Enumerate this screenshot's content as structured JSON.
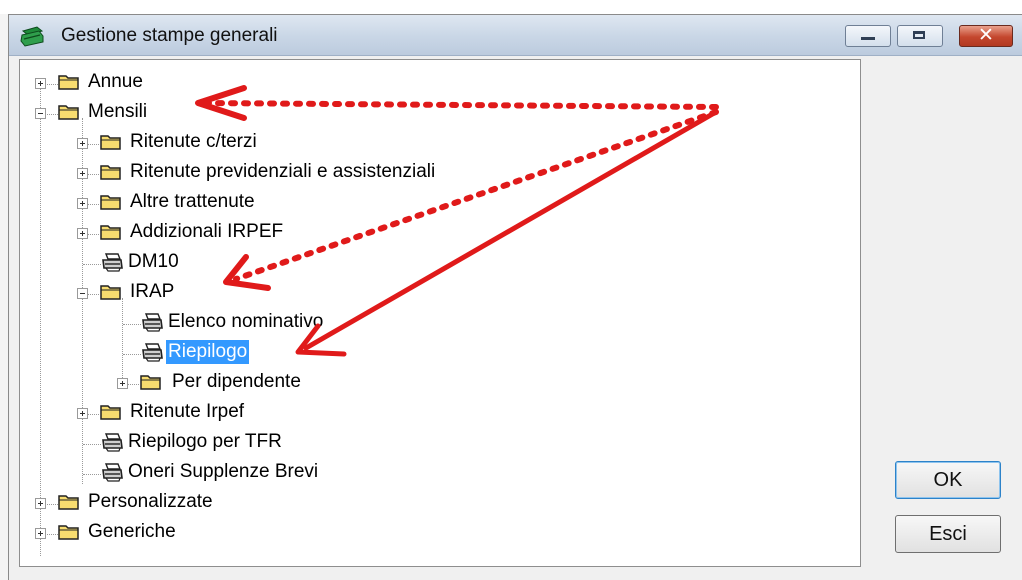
{
  "window": {
    "title": "Gestione stampe generali"
  },
  "tree": {
    "root_items": [
      {
        "label": "Annue",
        "type": "folder",
        "expanded": false
      },
      {
        "label": "Mensili",
        "type": "folder",
        "expanded": true
      },
      {
        "label": "Personalizzate",
        "type": "folder",
        "expanded": false
      },
      {
        "label": "Generiche",
        "type": "folder",
        "expanded": false
      }
    ],
    "mensili_children": [
      {
        "label": "Ritenute c/terzi",
        "type": "folder"
      },
      {
        "label": "Ritenute previdenziali e assistenziali",
        "type": "folder"
      },
      {
        "label": "Altre trattenute",
        "type": "folder"
      },
      {
        "label": "Addizionali IRPEF",
        "type": "folder"
      },
      {
        "label": "DM10",
        "type": "report"
      },
      {
        "label": "IRAP",
        "type": "folder",
        "expanded": true
      },
      {
        "label": "Ritenute Irpef",
        "type": "folder"
      },
      {
        "label": "Riepilogo per TFR",
        "type": "report"
      },
      {
        "label": "Oneri Supplenze Brevi",
        "type": "report"
      }
    ],
    "irap_children": [
      {
        "label": "Elenco nominativo",
        "type": "report"
      },
      {
        "label": "Riepilogo",
        "type": "report",
        "selected": true
      },
      {
        "label": "Per dipendente",
        "type": "folder"
      }
    ]
  },
  "buttons": {
    "ok_label": "OK",
    "esci_label": "Esci"
  },
  "colors": {
    "selection": "#3399ff",
    "annotation_arrows": "#e01a1a",
    "folder_fill": "#f7dc6f"
  },
  "icons": {
    "app": "printer-app-icon",
    "folder": "folder-icon",
    "report": "printer-icon"
  }
}
